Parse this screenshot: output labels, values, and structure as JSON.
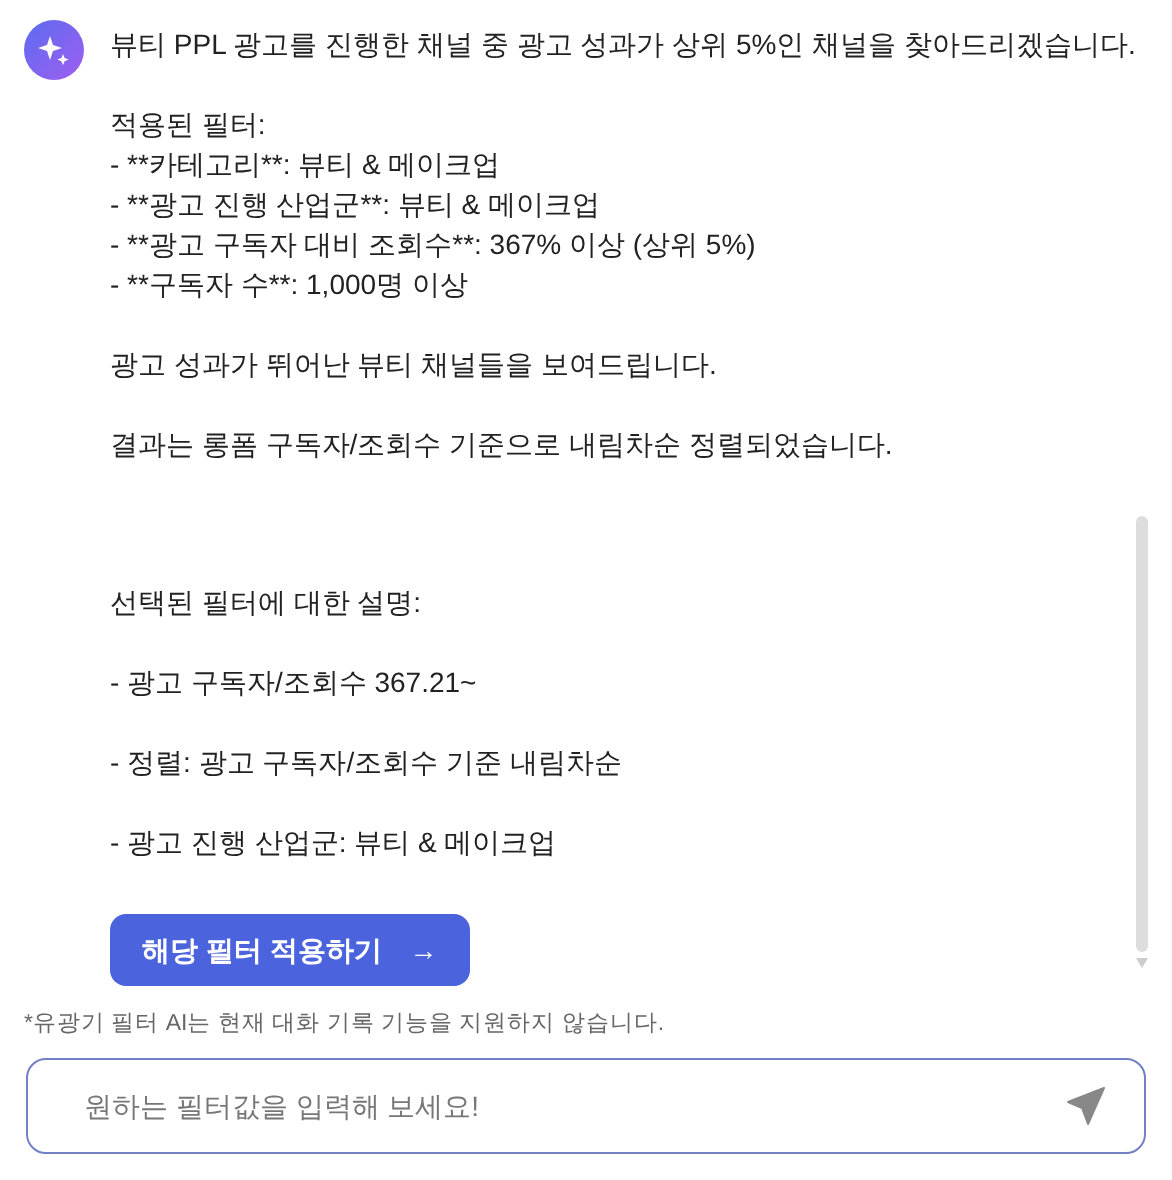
{
  "message": {
    "sections": [
      {
        "paragraphs": [
          [
            "뷰티 PPL 광고를 진행한 채널 중 광고 성과가 상위 5%인 채널을 찾아드리겠습니다."
          ],
          [
            "적용된 필터:",
            "- **카테고리**: 뷰티 & 메이크업",
            "- **광고 진행 산업군**: 뷰티 & 메이크업",
            "- **광고 구독자 대비 조회수**: 367% 이상 (상위 5%)",
            "- **구독자 수**: 1,000명 이상"
          ],
          [
            "광고 성과가 뛰어난 뷰티 채널들을 보여드립니다."
          ],
          [
            "결과는 롱폼 구독자/조회수 기준으로 내림차순 정렬되었습니다."
          ]
        ]
      },
      {
        "paragraphs": [
          [
            "선택된 필터에 대한 설명:"
          ],
          [
            "- 광고 구독자/조회수 367.21~"
          ],
          [
            "- 정렬: 광고 구독자/조회수 기준 내림차순"
          ],
          [
            "- 광고 진행 산업군: 뷰티 & 메이크업"
          ]
        ]
      }
    ],
    "button": {
      "label": "해당 필터 적용하기",
      "arrow": "→"
    }
  },
  "disclaimer": "*유광기 필터 AI는 현재 대화 기록 기능을 지원하지 않습니다.",
  "input": {
    "placeholder": "원하는 필터값을 입력해 보세요!"
  }
}
